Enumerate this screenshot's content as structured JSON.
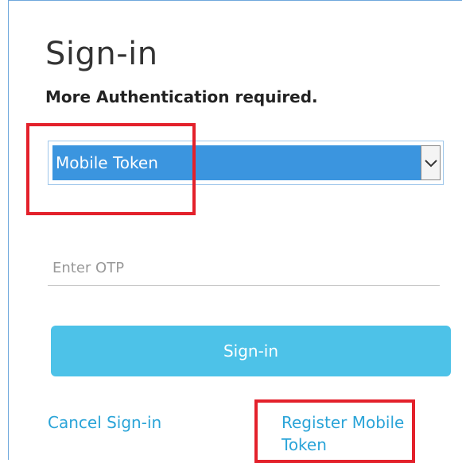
{
  "page": {
    "title": "Sign-in",
    "subtitle": "More Authentication required."
  },
  "auth_method": {
    "selected": "Mobile Token",
    "icon": "chevron-down-icon"
  },
  "otp": {
    "placeholder": "Enter OTP",
    "value": ""
  },
  "actions": {
    "signin_label": "Sign-in",
    "cancel_label": "Cancel Sign-in",
    "register_label": "Register Mobile Token"
  },
  "colors": {
    "select_highlight": "#3b95df",
    "button": "#4dc2e8",
    "link": "#2aa4d8",
    "annotation": "#e3212b"
  }
}
